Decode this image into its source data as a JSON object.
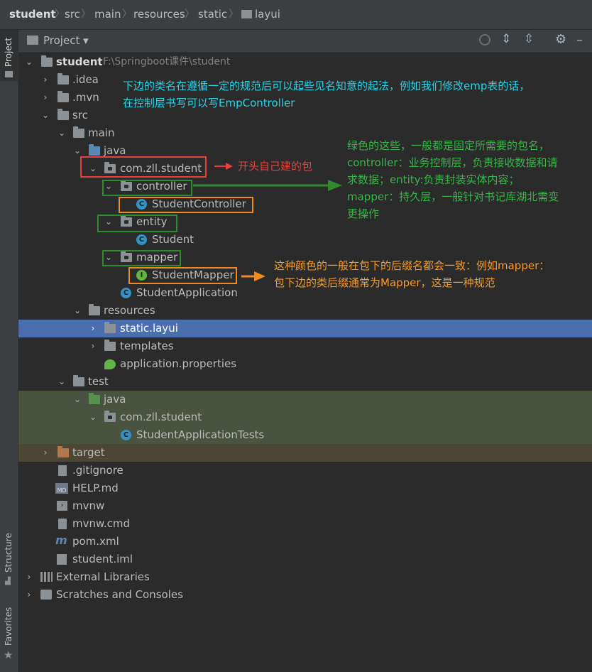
{
  "breadcrumb": [
    "student",
    "src",
    "main",
    "resources",
    "static",
    "layui"
  ],
  "sidebar": {
    "project_tab": "Project",
    "structure_tab": "Structure",
    "favorites_tab": "Favorites"
  },
  "panel": {
    "title": "Project",
    "dropdown": "▾"
  },
  "tree": {
    "root_name": "student",
    "root_path": "F:\\Springboot课件\\student",
    "idea": ".idea",
    "mvn": ".mvn",
    "src": "src",
    "main": "main",
    "java": "java",
    "pkg": "com.zll.student",
    "controller": "controller",
    "student_controller": "StudentController",
    "entity": "entity",
    "student": "Student",
    "mapper": "mapper",
    "student_mapper": "StudentMapper",
    "student_app": "StudentApplication",
    "resources": "resources",
    "static_layui": "static.layui",
    "templates": "templates",
    "app_props": "application.properties",
    "test": "test",
    "test_java": "java",
    "test_pkg": "com.zll.student",
    "app_tests": "StudentApplicationTests",
    "target": "target",
    "gitignore": ".gitignore",
    "help": "HELP.md",
    "mvnw": "mvnw",
    "mvnw_cmd": "mvnw.cmd",
    "pom": "pom.xml",
    "iml": "student.iml",
    "ext_libs": "External Libraries",
    "scratches": "Scratches and Consoles"
  },
  "annotations": {
    "top_line1": "下边的类名在遵循一定的规范后可以起些见名知意的起法，例如我们修改emp表的话，",
    "top_line2": "在控制层书写可以写EmpController",
    "red_note": "开头自己建的包",
    "green_line1": "绿色的这些，一般都是固定所需要的包名，",
    "green_line2": "controller：业务控制层，负责接收数据和请",
    "green_line3": "求数据；entity:负责封装实体内容；",
    "green_line4": "mapper：持久层，一般针对书记库湖北需变",
    "green_line5": "更操作",
    "orange_line1": "这种颜色的一般在包下的后缀名都会一致：例如mapper：",
    "orange_line2": "包下边的类后缀通常为Mapper，这是一种规范"
  },
  "colors": {
    "red": "#e8403a",
    "green": "#2e8b2e",
    "orange": "#f08a24",
    "cyan": "#28d4e6",
    "green_text": "#39b54a",
    "orange_text": "#f59a2a",
    "selection": "#4b6eaf",
    "test_band": "#49533f",
    "target_band": "#4e4634"
  }
}
